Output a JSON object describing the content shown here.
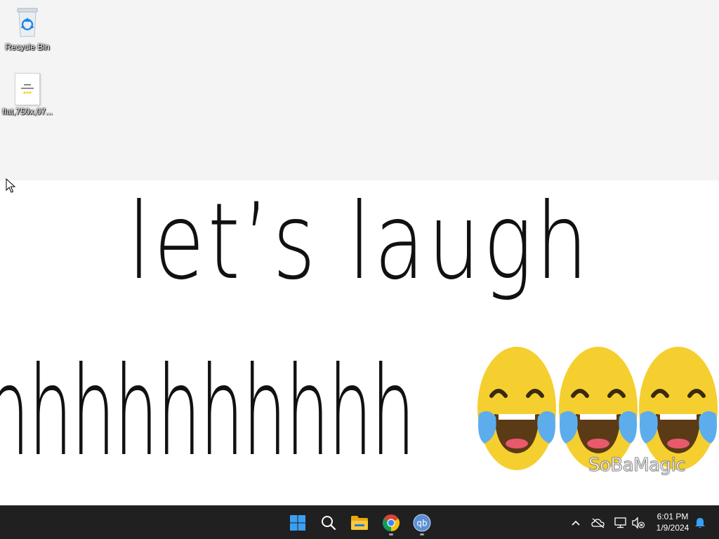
{
  "desktop": {
    "icons": [
      {
        "label": "Recycle Bin",
        "icon": "recycle-bin-icon"
      },
      {
        "label": "flat,750x,07...",
        "icon": "image-file-icon"
      }
    ]
  },
  "wallpaper": {
    "line1": "let’s laugh",
    "line2": "hhhhhhhhhh",
    "emoji": "face-with-tears-of-joy",
    "watermark": "SoBaMagic"
  },
  "taskbar": {
    "pinned": [
      {
        "name": "start",
        "icon": "windows-logo-icon"
      },
      {
        "name": "search",
        "icon": "search-icon"
      },
      {
        "name": "file-explorer",
        "icon": "folder-icon"
      },
      {
        "name": "chrome",
        "icon": "chrome-icon"
      },
      {
        "name": "qbittorrent",
        "icon": "qbittorrent-icon",
        "text": "qb"
      }
    ],
    "tray": {
      "icons": [
        "chevron-up-icon",
        "onedrive-offline-icon",
        "network-icon",
        "volume-muted-icon",
        "notification-bell-icon"
      ]
    },
    "clock": {
      "time": "6:01 PM",
      "date": "1/9/2024"
    }
  },
  "colors": {
    "taskbar_bg": "#202020",
    "desktop_bg": "#f4f4f4",
    "emoji_yellow": "#f5cf2f",
    "emoji_tear": "#5dadec",
    "windows_blue": "#1e90ff"
  }
}
